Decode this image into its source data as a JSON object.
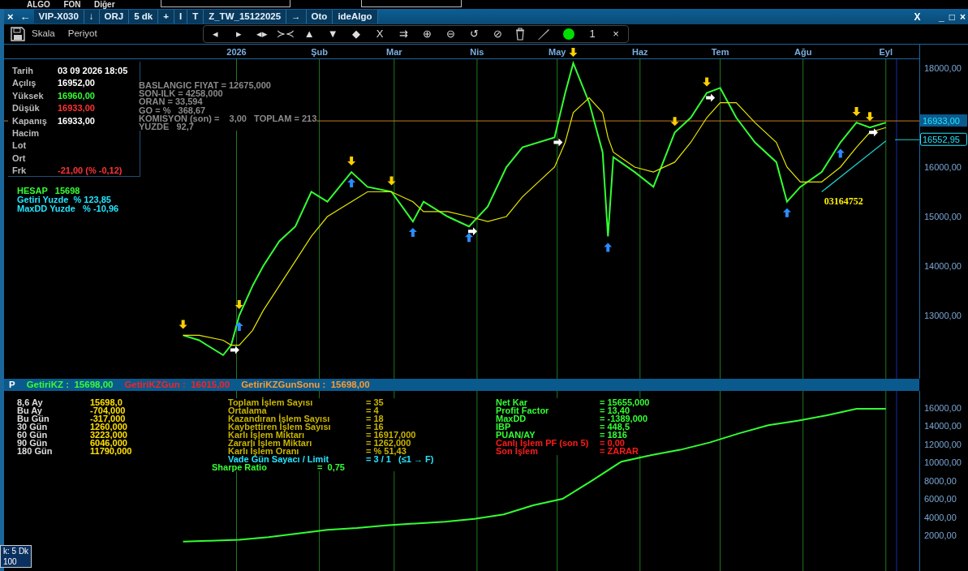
{
  "menu_strip": {
    "items": [
      "ALGO",
      "FON",
      "Diğer"
    ]
  },
  "tabs": [
    {
      "kind": "icon",
      "text": "×"
    },
    {
      "kind": "icon",
      "text": "←"
    },
    {
      "kind": "tab",
      "text": "VIP-X030"
    },
    {
      "kind": "tab",
      "text": "↓"
    },
    {
      "kind": "tab",
      "text": "ORJ"
    },
    {
      "kind": "tab",
      "text": "5 dk"
    },
    {
      "kind": "tab",
      "text": "+"
    },
    {
      "kind": "tab",
      "text": "I"
    },
    {
      "kind": "tab",
      "text": "T"
    },
    {
      "kind": "tab",
      "text": "Z_TW_15122025"
    },
    {
      "kind": "tab",
      "text": "→"
    },
    {
      "kind": "tab",
      "text": "Oto"
    },
    {
      "kind": "tab",
      "text": "ideAlgo"
    }
  ],
  "title_bar": {
    "close_mark": "X",
    "controls": [
      "_",
      "□",
      "×"
    ]
  },
  "toolbar": {
    "menus": [
      "Skala",
      "Periyot"
    ],
    "buttons": [
      {
        "kind": "glyph",
        "text": "◂"
      },
      {
        "kind": "glyph",
        "text": "▸"
      },
      {
        "kind": "glyph",
        "text": "◂▸"
      },
      {
        "kind": "glyph",
        "text": "≻≺"
      },
      {
        "kind": "glyph",
        "text": "▲"
      },
      {
        "kind": "glyph",
        "text": "▼"
      },
      {
        "kind": "glyph",
        "text": "◆"
      },
      {
        "kind": "glyph",
        "text": "X"
      },
      {
        "kind": "glyph",
        "text": "⇉"
      },
      {
        "kind": "glyph",
        "text": "⊕"
      },
      {
        "kind": "glyph",
        "text": "⊖"
      },
      {
        "kind": "glyph",
        "text": "↺"
      },
      {
        "kind": "glyph",
        "text": "⊘"
      },
      {
        "kind": "trash"
      },
      {
        "kind": "pen"
      },
      {
        "kind": "dot"
      },
      {
        "kind": "glyph",
        "text": "1"
      },
      {
        "kind": "glyph",
        "text": "×"
      }
    ]
  },
  "price_chart": {
    "info_box": [
      {
        "label": "Tarih",
        "value": "03 09 2026 18:05",
        "kind": "plain"
      },
      {
        "label": "Açılış",
        "value": "16952,00",
        "kind": "plain"
      },
      {
        "label": "Yüksek",
        "value": "16960,00",
        "kind": "up"
      },
      {
        "label": "Düşük",
        "value": "16933,00",
        "kind": "down"
      },
      {
        "label": "Kapanış",
        "value": "16933,00",
        "kind": "plain"
      },
      {
        "label": "Hacim"
      },
      {
        "label": "Lot"
      },
      {
        "label": "Ort"
      },
      {
        "label": "Frk",
        "value": "-21,00 (% -0,12)",
        "kind": "down"
      }
    ],
    "strategy_text": [
      "BASLANGIC FIYAT = 12675,000",
      "SON-ILK = 4258,000",
      "ORAN = 33,594",
      "GO = %   368,67",
      "KOMISYON (son) =    3,00   TOPLAM = 213",
      "YUZDE   92,7"
    ],
    "account": [
      {
        "text": "HESAP   15698",
        "color": "#33ff33"
      },
      {
        "text": "Getiri Yuzde  % 123,85",
        "color": "#22e6ff"
      },
      {
        "text": "MaxDD Yuzde   % -10,96",
        "color": "#22e6ff"
      }
    ],
    "chart_data": {
      "type": "line",
      "x": [
        "2025-12-12",
        "2025-12-18",
        "2025-12-27",
        "2025-12-30",
        "2026-01-02",
        "2026-01-07",
        "2026-01-11",
        "2026-01-17",
        "2026-01-23",
        "2026-01-29",
        "2026-02-04",
        "2026-02-13",
        "2026-02-19",
        "2026-02-28",
        "2026-03-08",
        "2026-03-12",
        "2026-03-21",
        "2026-03-29",
        "2026-04-05",
        "2026-04-12",
        "2026-04-18",
        "2026-04-30",
        "2026-05-04",
        "2026-05-07",
        "2026-05-13",
        "2026-05-18",
        "2026-05-20",
        "2026-05-22",
        "2026-05-30",
        "2026-06-06",
        "2026-06-14",
        "2026-06-20",
        "2026-06-26",
        "2026-07-01",
        "2026-07-07",
        "2026-07-14",
        "2026-07-22",
        "2026-07-26",
        "2026-07-31",
        "2026-08-08",
        "2026-08-15",
        "2026-08-21",
        "2026-08-26",
        "2026-09-01"
      ],
      "series": [
        {
          "color": "#33ff33",
          "values": [
            12600,
            12500,
            12200,
            12400,
            13000,
            13600,
            14000,
            14500,
            14800,
            15500,
            15300,
            15900,
            15600,
            15500,
            14900,
            15300,
            15000,
            14800,
            15200,
            16000,
            16400,
            16600,
            17500,
            18100,
            17300,
            16300,
            14600,
            16200,
            15900,
            15600,
            16700,
            17000,
            17500,
            17600,
            17000,
            16500,
            16100,
            15300,
            15600,
            15900,
            16500,
            16900,
            16800,
            16900
          ]
        },
        {
          "color": "#e6e600",
          "values": [
            12600,
            12600,
            12500,
            12400,
            12400,
            12700,
            13100,
            13600,
            14100,
            14600,
            15000,
            15300,
            15500,
            15500,
            15300,
            15100,
            15100,
            15000,
            14900,
            15000,
            15400,
            16000,
            16500,
            17100,
            17400,
            17100,
            16600,
            16300,
            16000,
            15900,
            16100,
            16500,
            17000,
            17300,
            17300,
            16900,
            16500,
            16000,
            15700,
            15700,
            16000,
            16400,
            16700,
            16800
          ]
        },
        {
          "color": "#22cccc",
          "values": [
            null,
            null,
            null,
            null,
            null,
            null,
            null,
            null,
            null,
            null,
            null,
            null,
            null,
            null,
            null,
            null,
            null,
            null,
            null,
            null,
            null,
            null,
            null,
            null,
            null,
            null,
            null,
            null,
            null,
            null,
            null,
            null,
            null,
            null,
            null,
            null,
            null,
            null,
            null,
            15500,
            null,
            null,
            null,
            16530
          ]
        }
      ],
      "xlim": [
        "2025-10-06",
        "2026-09-12"
      ],
      "ylim": [
        11721,
        18180
      ],
      "xticks": [
        {
          "value": "2026-01-01",
          "label": "2026"
        },
        {
          "value": "2026-02-01",
          "label": "Şub"
        },
        {
          "value": "2026-03-01",
          "label": "Mar"
        },
        {
          "value": "2026-04-01",
          "label": "Nis"
        },
        {
          "value": "2026-05-01",
          "label": "May"
        },
        {
          "value": "2026-06-01",
          "label": "Haz"
        },
        {
          "value": "2026-07-01",
          "label": "Tem"
        },
        {
          "value": "2026-08-01",
          "label": "Ağu"
        },
        {
          "value": "2026-09-01",
          "label": "Eyl"
        }
      ],
      "yticks": [
        {
          "value": 18000,
          "label": "18000,00"
        },
        {
          "value": 16000,
          "label": "16000,00"
        },
        {
          "value": 15000,
          "label": "15000,00"
        },
        {
          "value": 14000,
          "label": "14000,00"
        },
        {
          "value": 13000,
          "label": "13000,00"
        }
      ],
      "grid": true,
      "ref_lines": [
        {
          "axis": "y",
          "value": 16933,
          "label": "16933,00"
        },
        {
          "axis": "y",
          "value": 16552.95,
          "label": "16552,95"
        },
        {
          "axis": "x",
          "value": "2026-09-05"
        }
      ],
      "annotations": [
        {
          "text": "03164752"
        }
      ]
    }
  },
  "panel": {
    "header": [
      {
        "text": "P",
        "kind": "title"
      },
      {
        "text": "GetiriKZ :  15698,00",
        "kind": "gain"
      },
      {
        "text": "GetiriKZGun :  16015,00",
        "kind": "loss"
      },
      {
        "text": "GetiriKZGunSonu :  15698,00",
        "kind": "closing"
      }
    ],
    "periods": [
      {
        "label": "8,6 Ay",
        "value": "15698,0"
      },
      {
        "label": "Bu Ay",
        "value": "-704,000"
      },
      {
        "label": "Bu Gün",
        "value": "-317,000"
      },
      {
        "label": "30 Gün",
        "value": "1260,000"
      },
      {
        "label": "60 Gün",
        "value": "3223,000"
      },
      {
        "label": "90 Gün",
        "value": "6046,000"
      },
      {
        "label": "180 Gün",
        "value": "11790,000"
      }
    ],
    "metrics": [
      {
        "label": "Toplam İşlem Sayısı",
        "value": "= 35",
        "color": "#c8b400"
      },
      {
        "label": "Ortalama",
        "value": "= 4",
        "color": "#c8b400"
      },
      {
        "label": "Kazandıran İşlem Sayısı",
        "value": "= 18",
        "color": "#c8b400"
      },
      {
        "label": "Kaybettiren İşlem Sayısı",
        "value": "= 16",
        "color": "#c8b400"
      },
      {
        "label": "Karlı İşlem Miktarı",
        "value": "= 16917,000",
        "color": "#c8b400"
      },
      {
        "label": "Zararlı İşlem Miktarı",
        "value": "= 1262,000",
        "color": "#c8b400"
      },
      {
        "label": "Karlı İşlem Oranı",
        "value": "= % 51,43",
        "color": "#c8b400"
      },
      {
        "label": "Vade Gün Sayacı / Limit",
        "value": "= 3 / 1   (≤1 → F)",
        "color": "#22e6ff"
      }
    ],
    "sharpe": {
      "label": "Sharpe Ratio",
      "value": "=  0,75"
    },
    "results": [
      {
        "label": "Net Kar",
        "value": "= 15655,000",
        "color": "#33ff33"
      },
      {
        "label": "Profit Factor",
        "value": "= 13,40",
        "color": "#33ff33"
      },
      {
        "label": "MaxDD",
        "value": "= -1389,000",
        "color": "#33ff33"
      },
      {
        "label": "IBP",
        "value": "= 448,5",
        "color": "#33ff33"
      },
      {
        "label": "PUAN/AY",
        "value": "= 1816",
        "color": "#33ff33"
      },
      {
        "label": "Canlı İşlem PF (son 5)",
        "value": "= 0,00",
        "color": "#ff1a1a"
      },
      {
        "label": "Son İşlem",
        "value": "= ZARAR",
        "color": "#ff1a1a"
      }
    ],
    "chart_data": {
      "type": "line",
      "grid": true,
      "series": [
        {
          "color": "#33ff33",
          "values": [
            1300,
            1400,
            1500,
            1800,
            2200,
            2600,
            2800,
            3100,
            3300,
            3500,
            3800,
            4300,
            5300,
            6000,
            8000,
            10100,
            10800,
            11400,
            12200,
            13200,
            14100,
            14600,
            15200,
            15900,
            15900
          ]
        }
      ],
      "ylim": [
        -1925,
        17873
      ],
      "yticks": [
        {
          "value": 16000,
          "label": "16000,00"
        },
        {
          "value": 14000,
          "label": "14000,00"
        },
        {
          "value": 12000,
          "label": "12000,00"
        },
        {
          "value": 10000,
          "label": "10000,00"
        },
        {
          "value": 8000,
          "label": "8000,00"
        },
        {
          "value": 6000,
          "label": "6000,00"
        },
        {
          "value": 4000,
          "label": "4000,00"
        },
        {
          "value": 2000,
          "label": "2000,00"
        }
      ]
    }
  },
  "cursor_box": [
    "k: 5 Dk",
    "100"
  ]
}
